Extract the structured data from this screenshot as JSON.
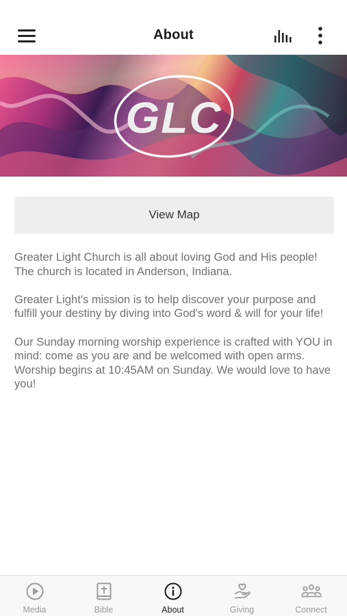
{
  "header": {
    "title": "About",
    "menu_icon": "hamburger-menu-icon",
    "audio_icon": "audio-bars-icon",
    "more_icon": "vertical-ellipsis-icon"
  },
  "banner": {
    "logo_text": "GLC"
  },
  "view_map_label": "View Map",
  "paragraphs": [
    "Greater Light Church is all about loving God and His people! The church is located in Anderson, Indiana.",
    "Greater Light's mission is to help discover your purpose and fulfill your destiny by diving into God's word & will for your life!",
    "Our Sunday morning worship experience is crafted with YOU in mind: come as you are and be welcomed with open arms. Worship begins at 10:45AM on Sunday. We would love to have you!"
  ],
  "tabs": [
    {
      "label": "Media",
      "icon": "play-circle-icon",
      "active": false
    },
    {
      "label": "Bible",
      "icon": "bible-cross-icon",
      "active": false
    },
    {
      "label": "About",
      "icon": "info-circle-icon",
      "active": true
    },
    {
      "label": "Giving",
      "icon": "giving-hand-heart-icon",
      "active": false
    },
    {
      "label": "Connect",
      "icon": "people-group-icon",
      "active": false
    }
  ],
  "colors": {
    "active_tab": "#1a1a1a",
    "inactive_tab": "#9a9a9a",
    "body_text": "#707070",
    "map_button_bg": "#eeeeef"
  }
}
